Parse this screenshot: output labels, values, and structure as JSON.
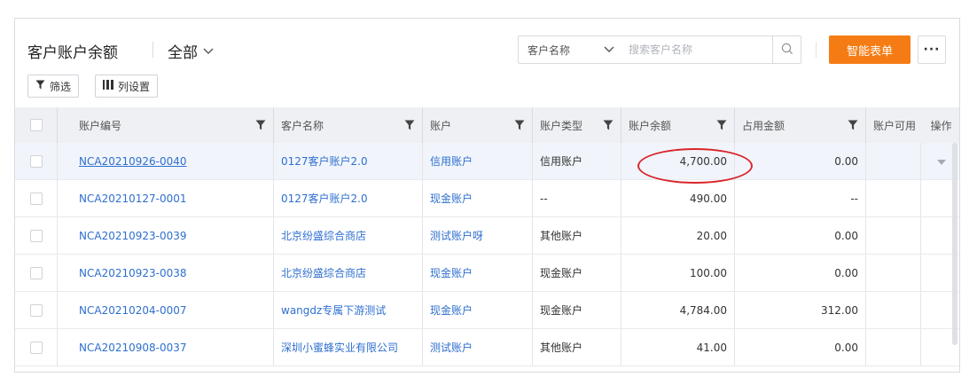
{
  "header": {
    "title": "客户账户余额",
    "view": "全部",
    "search_field": "客户名称",
    "search_placeholder": "搜索客户名称",
    "primary_button": "智能表单",
    "more_button": "···"
  },
  "toolbar": {
    "filter_label": "筛选",
    "columns_label": "列设置"
  },
  "table": {
    "columns": [
      "账户编号",
      "客户名称",
      "账户",
      "账户类型",
      "账户余额",
      "占用金额",
      "账户可用",
      "操作"
    ],
    "rows": [
      {
        "id": "NCA20210926-0040",
        "customer": "0127客户账户2.0",
        "account": "信用账户",
        "type": "信用账户",
        "balance": "4,700.00",
        "occupied": "0.00"
      },
      {
        "id": "NCA20210127-0001",
        "customer": "0127客户账户2.0",
        "account": "现金账户",
        "type": "--",
        "balance": "490.00",
        "occupied": "--"
      },
      {
        "id": "NCA20210923-0039",
        "customer": "北京纷盛综合商店",
        "account": "测试账户呀",
        "type": "其他账户",
        "balance": "20.00",
        "occupied": "0.00"
      },
      {
        "id": "NCA20210923-0038",
        "customer": "北京纷盛综合商店",
        "account": "现金账户",
        "type": "现金账户",
        "balance": "100.00",
        "occupied": "0.00"
      },
      {
        "id": "NCA20210204-0007",
        "customer": "wangdz专属下游测试",
        "account": "现金账户",
        "type": "现金账户",
        "balance": "4,784.00",
        "occupied": "312.00"
      },
      {
        "id": "NCA20210908-0037",
        "customer": "深圳小蜜蜂实业有限公司",
        "account": "测试账户",
        "type": "其他账户",
        "balance": "41.00",
        "occupied": "0.00"
      }
    ]
  },
  "colors": {
    "accent": "#f57c14",
    "link": "#2f6fcf",
    "highlight_ring": "#d9262b"
  }
}
